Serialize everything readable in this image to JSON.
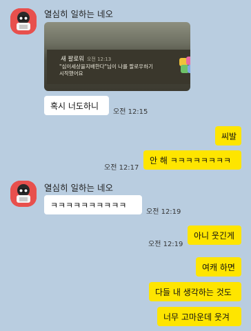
{
  "sender_name": "열심히 일하는 네오",
  "photo": {
    "title": "새 팔로워",
    "time": "오전 12:13",
    "line1": "\"심이세상을지배한다\"님이 나를 팔로우하기",
    "line2": "시작했어요"
  },
  "messages": [
    {
      "text": "혹시 너도하니",
      "time": "오전 12:15"
    },
    {
      "text": "씨발"
    },
    {
      "text": "안 해 ㅋㅋㅋㅋㅋㅋㅋㅋ",
      "time": "오전 12:17"
    },
    {
      "text": "ㅋㅋㅋㅋㅋㅋㅋㅋㅋㅋ",
      "time": "오전 12:19"
    },
    {
      "text": "아니 웃긴게",
      "time": "오전 12:19"
    },
    {
      "text": "여캐 하면"
    },
    {
      "text": "다들 내 생각하는 것도"
    },
    {
      "text": "너무 고마운데 웃겨"
    }
  ]
}
